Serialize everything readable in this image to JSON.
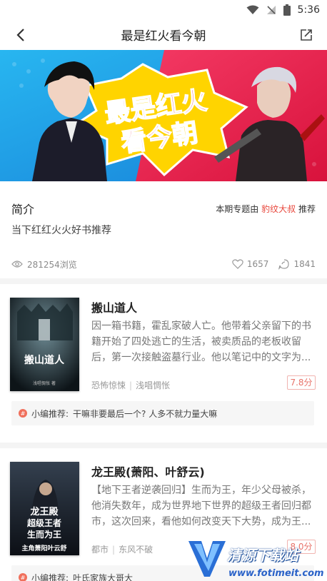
{
  "status_bar": {
    "time": "5:36"
  },
  "nav": {
    "title": "最是红火看今朝"
  },
  "banner": {
    "text_line1": "最是红火",
    "text_line2": "看今朝"
  },
  "intro": {
    "heading": "简介",
    "recommend_prefix": "本期专题由",
    "recommend_author": "豹纹大叔",
    "recommend_suffix": "推荐",
    "description": "当下红红火火好书推荐",
    "views": "281254浏览",
    "likes": "1657",
    "comments": "1841"
  },
  "books": [
    {
      "title": "搬山道人",
      "description": "因一箱书籍，霍乱家破人亡。他带着父亲留下的书籍开始了四处逃亡的生活，被卖质品的老板收留后，第一次接触盗墓行业。他以笔记中的文字为...",
      "tag1": "恐怖惊悚",
      "tag2": "浅唱惆怅",
      "score": "7.8分",
      "editor_label": "小编推荐:",
      "editor_comment": "干嘛非要最后一个? 人多不就力量大嘛",
      "cover_title": "搬山道人",
      "cover_author": "浅唱惆怅 著"
    },
    {
      "title": "龙王殿(萧阳、叶舒云)",
      "description": "【地下王者逆袭回归】生而为王，年少父母被杀，他消失数年，成为世界地下世界的超级王者回归都市，这次回来，看他如何改变天下大势，成为王...",
      "tag1": "都市",
      "tag2": "东风不破",
      "score": "8.0分",
      "editor_label": "小编推荐:",
      "editor_comment": "叶氏家族大哥大",
      "cover_line1": "龙王殿",
      "cover_line2": "超级王者",
      "cover_line3": "生而为王",
      "cover_line4": "主角萧阳叶云舒"
    }
  ],
  "watermark": {
    "title": "清源下载站",
    "url": "www.fotimeit.com"
  },
  "colors": {
    "accent": "#e8473c",
    "banner_red": "#e9254e",
    "banner_blue": "#1fa0e8",
    "banner_yellow": "#ffd400"
  }
}
